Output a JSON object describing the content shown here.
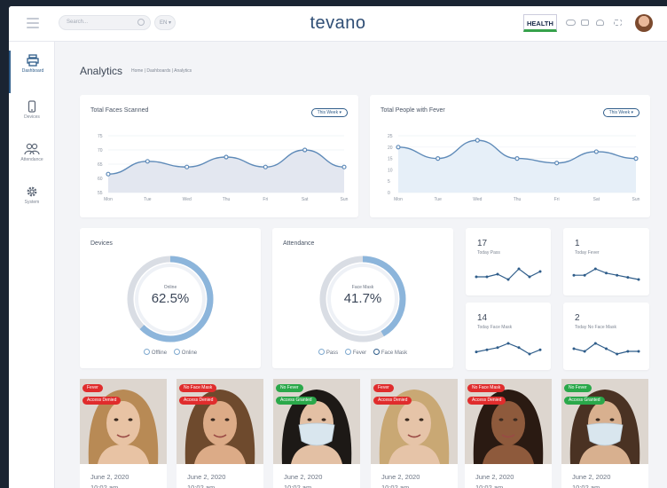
{
  "app": {
    "logo": "tevano",
    "partner_logo": "HEALTH"
  },
  "topbar": {
    "search_placeholder": "Search...",
    "language": "EN"
  },
  "sidebar": {
    "items": [
      {
        "label": "Dashboard",
        "icon": "printer-icon",
        "active": true
      },
      {
        "label": "Devices",
        "icon": "device-icon",
        "active": false
      },
      {
        "label": "Attendance",
        "icon": "users-icon",
        "active": false
      },
      {
        "label": "System",
        "icon": "gear-icon",
        "active": false
      }
    ]
  },
  "page": {
    "title": "Analytics",
    "breadcrumb": "Home  |  Dashboards  |  Analytics"
  },
  "cards": {
    "faces": {
      "title": "Total Faces Scanned",
      "filter": "This Week"
    },
    "fever": {
      "title": "Total People with Fever",
      "filter": "This Week"
    },
    "devices": {
      "title": "Devices",
      "center_label": "Online",
      "center_value": "62.5%",
      "value_fraction": 0.625,
      "legend": [
        "Offline",
        "Online"
      ]
    },
    "attendance": {
      "title": "Attendance",
      "center_label": "Face Mask",
      "center_value": "41.7%",
      "value_fraction": 0.417,
      "legend": [
        "Pass",
        "Fever",
        "Face Mask"
      ]
    }
  },
  "minis": [
    {
      "value": "17",
      "label": "Today Pass"
    },
    {
      "value": "1",
      "label": "Today Fever"
    },
    {
      "value": "14",
      "label": "Today Face Mask"
    },
    {
      "value": "2",
      "label": "Today No Face Mask"
    }
  ],
  "photos": [
    {
      "badges": [
        {
          "text": "Fever",
          "color": "red"
        },
        {
          "text": "Access Denied",
          "color": "red"
        }
      ],
      "date": "June 2, 2020",
      "time": "10:02 am",
      "mask": false,
      "hair": "#b88a55",
      "skin": "#e8c3a4"
    },
    {
      "badges": [
        {
          "text": "No Face Mask",
          "color": "red"
        },
        {
          "text": "Access Denied",
          "color": "red"
        }
      ],
      "date": "June 2, 2020",
      "time": "10:02 am",
      "mask": false,
      "hair": "#6e4a2d",
      "skin": "#dcab87"
    },
    {
      "badges": [
        {
          "text": "No Fever",
          "color": "green"
        },
        {
          "text": "Access Granted",
          "color": "green"
        }
      ],
      "date": "June 2, 2020",
      "time": "10:02 am",
      "mask": true,
      "hair": "#1d1916",
      "skin": "#e3c0a4"
    },
    {
      "badges": [
        {
          "text": "Fever",
          "color": "red"
        },
        {
          "text": "Access Denied",
          "color": "red"
        }
      ],
      "date": "June 2, 2020",
      "time": "10:02 am",
      "mask": false,
      "hair": "#c9a874",
      "skin": "#e6c4a8"
    },
    {
      "badges": [
        {
          "text": "No Face Mask",
          "color": "red"
        },
        {
          "text": "Access Denied",
          "color": "red"
        }
      ],
      "date": "June 2, 2020",
      "time": "10:02 am",
      "mask": false,
      "hair": "#2a1a12",
      "skin": "#8e5a3c"
    },
    {
      "badges": [
        {
          "text": "No Fever",
          "color": "green"
        },
        {
          "text": "Access Granted",
          "color": "green"
        }
      ],
      "date": "June 2, 2020",
      "time": "10:02 am",
      "mask": true,
      "hair": "#4a3223",
      "skin": "#d8b08f"
    }
  ],
  "chart_data": [
    {
      "type": "area",
      "categories": [
        "Mon",
        "Tue",
        "Wed",
        "Thu",
        "Fri",
        "Sat",
        "Sun"
      ],
      "values": [
        48,
        57,
        53,
        60,
        53,
        65,
        53
      ],
      "ylim": [
        35,
        75
      ],
      "yticks": [
        "75",
        "70",
        "65",
        "60",
        "55"
      ],
      "grid": true
    },
    {
      "type": "area",
      "categories": [
        "Mon",
        "Tue",
        "Wed",
        "Thu",
        "Fri",
        "Sat",
        "Sun"
      ],
      "values": [
        20,
        15,
        23,
        15,
        13,
        18,
        15
      ],
      "ylim": [
        0,
        25
      ],
      "yticks": [
        "25",
        "20",
        "15",
        "10",
        "5",
        "0"
      ],
      "grid": true
    },
    {
      "type": "line",
      "values": [
        3,
        3,
        4,
        2,
        6,
        3,
        5
      ]
    },
    {
      "type": "line",
      "values": [
        3,
        3,
        6,
        4,
        3,
        2,
        1
      ]
    },
    {
      "type": "line",
      "values": [
        2,
        3,
        4,
        6,
        4,
        1,
        3
      ]
    },
    {
      "type": "line",
      "values": [
        4,
        3,
        6,
        4,
        2,
        3,
        3
      ]
    }
  ]
}
